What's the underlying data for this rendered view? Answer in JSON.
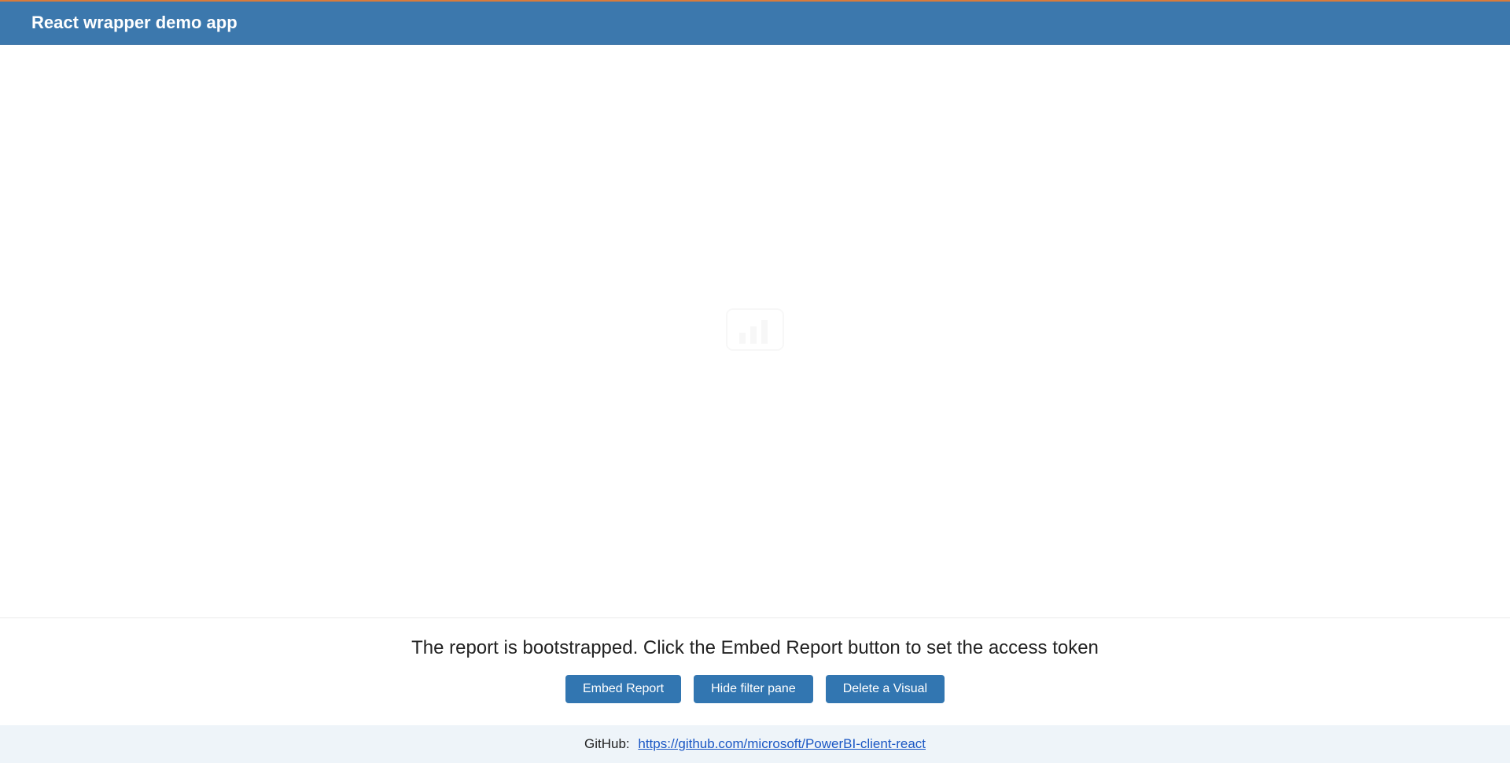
{
  "header": {
    "title": "React wrapper demo app"
  },
  "report": {
    "placeholder_icon": "powerbi-logo"
  },
  "status": {
    "message": "The report is bootstrapped. Click the Embed Report button to set the access token"
  },
  "buttons": {
    "embed": "Embed Report",
    "hide_filter": "Hide filter pane",
    "delete_visual": "Delete a Visual"
  },
  "footer": {
    "label": "GitHub:",
    "link_text": "https://github.com/microsoft/PowerBI-client-react"
  }
}
